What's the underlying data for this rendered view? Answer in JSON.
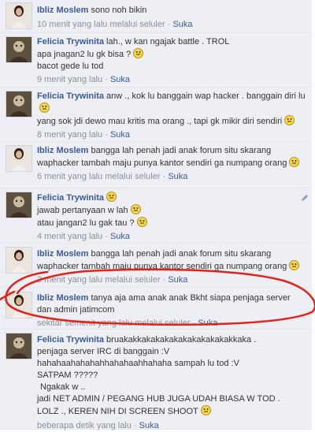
{
  "comments": [
    {
      "author": "Ibliz Moslem",
      "lines": [
        "sono noh bikin"
      ],
      "time": "10 menit yang lalu melalui seluler",
      "like": "Suka",
      "avatar": "female-photo"
    },
    {
      "author": "Felicia Trywinita",
      "lines": [
        "lah., w kan ngajak battle . TROL",
        "apa jnagan2 lu gk bisa ?",
        "bacot gede lu tod"
      ],
      "time": "9 menit yang lalu",
      "like": "Suka",
      "avatar": "cartoon-photo"
    },
    {
      "author": "Felicia Trywinita",
      "lines": [
        "anw ., kok lu banggain wap hacker . banggain diri lu",
        "yang sok jdi dewo mau kritis ma orang ., tapi gk mikir diri sendiri"
      ],
      "time": "8 menit yang lalu",
      "like": "Suka",
      "avatar": "cartoon-photo"
    },
    {
      "author": "Ibliz Moslem",
      "lines": [
        "bangga lah penah jadi anak forum situ skarang",
        "waphacker tambah maju punya kantor sendiri ga numpang orang"
      ],
      "time": "6 menit yang lalu melalui seluler",
      "like": "Suka",
      "avatar": "female-photo"
    },
    {
      "author": "Felicia Trywinita",
      "lines": [
        "",
        "jawab pertanyaan w lah",
        "atau jangan2 lu gak tau ?"
      ],
      "time": "4 menit yang lalu",
      "like": "Suka",
      "avatar": "cartoon-photo"
    },
    {
      "author": "Ibliz Moslem",
      "lines": [
        "bangga lah penah jadi anak forum situ skarang",
        "waphacker tambah maju punya kantor sendiri ga numpang orang"
      ],
      "time": "2 menit yang lalu melalui seluler",
      "like": "Suka",
      "avatar": "female-photo"
    },
    {
      "author": "Ibliz Moslem",
      "lines": [
        "tanya aja ama anak anak Bkht siapa penjaga server",
        "dan admin jatimcom"
      ],
      "time": "sekitar semenit yang lalu melalui seluler",
      "like": "Suka",
      "avatar": "female-photo"
    },
    {
      "author": "Felicia Trywinita",
      "lines": [
        "bruakakkakakakakakakakakakakkaka .",
        "penjaga server IRC di banggain :V",
        "hahahaahahahahhahahaahhahaha sampah lu tod :V",
        "SATPAM ?????",
        "Ngakak w ..",
        "jadi NET ADMIN / PEGANG HUB JUGA UDAH BIASA W TOD .",
        "LOLZ ., KEREN NIH DI SCREEN SHOOT"
      ],
      "time": "beberapa detik yang lalu",
      "like": "Suka",
      "avatar": "cartoon-photo"
    }
  ],
  "separator": "·",
  "colors": {
    "name": "#3b5998",
    "bg": "#edeff4",
    "meta": "#8a8f9c",
    "annotation": "#e2231a"
  }
}
